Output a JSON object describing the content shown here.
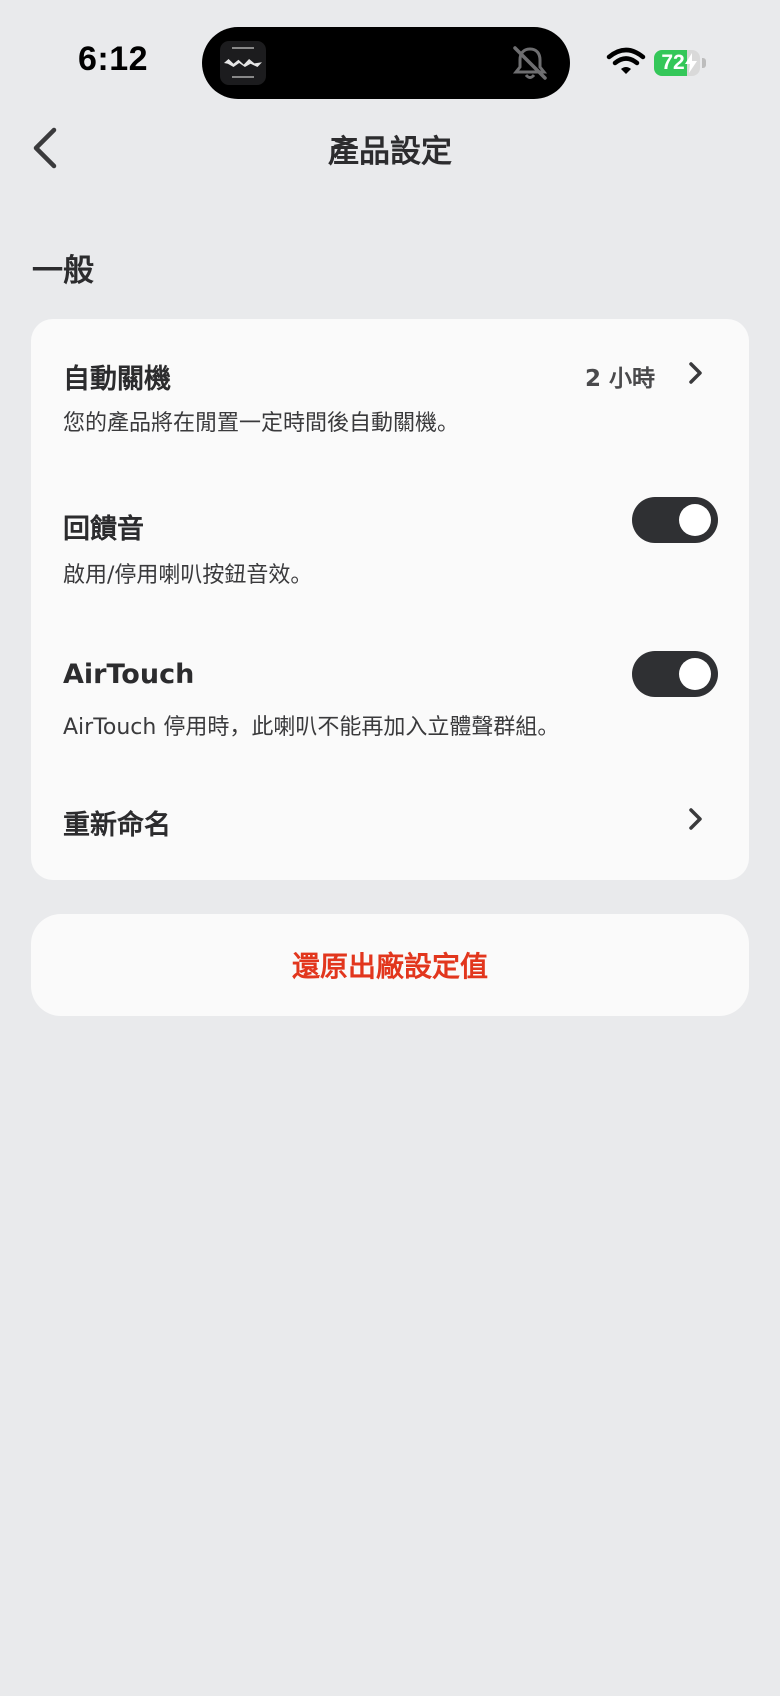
{
  "status_bar": {
    "time": "6:12",
    "battery": "72"
  },
  "nav": {
    "title": "產品設定"
  },
  "section": {
    "title": "一般"
  },
  "settings": {
    "auto_off": {
      "title": "自動關機",
      "value": "2 小時",
      "description": "您的產品將在閒置一定時間後自動關機。"
    },
    "feedback_tone": {
      "title": "回饋音",
      "description": "啟用/停用喇叭按鈕音效。",
      "enabled": true
    },
    "airtouch": {
      "title": "AirTouch",
      "description": "AirTouch 停用時，此喇叭不能再加入立體聲群組。",
      "enabled": true
    },
    "rename": {
      "title": "重新命名"
    }
  },
  "reset": {
    "label": "還原出廠設定值"
  },
  "colors": {
    "background": "#e9eaec",
    "card": "#fafafa",
    "toggle_on": "#2f3033",
    "danger": "#e2361d",
    "battery": "#34c759"
  },
  "icons": {
    "back": "chevron-left-icon",
    "chevron": "chevron-right-icon",
    "wifi": "wifi-icon",
    "mute": "bell-slash-icon"
  }
}
